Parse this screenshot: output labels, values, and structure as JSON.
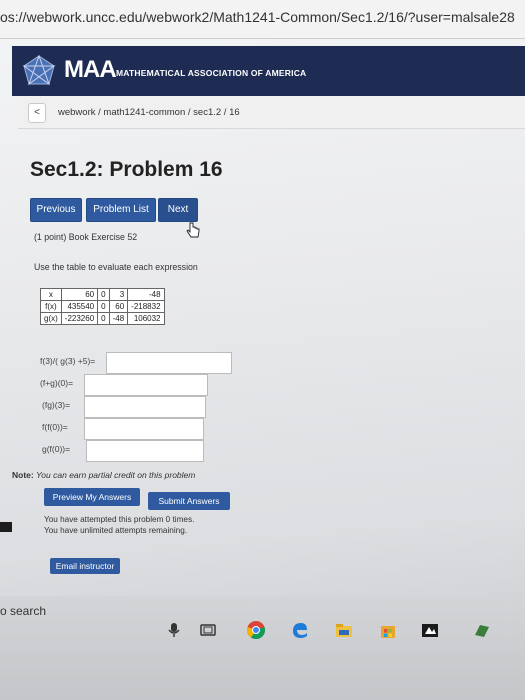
{
  "browser": {
    "url": "os://webwork.uncc.edu/webwork2/Math1241-Common/Sec1.2/16/?user=malsale28"
  },
  "header": {
    "logo_text": "MAA",
    "org_name": "MATHEMATICAL ASSOCIATION OF AMERICA"
  },
  "breadcrumb": {
    "back": "<",
    "path": "webwork / math1241-common / sec1.2 / 16"
  },
  "page": {
    "title": "Sec1.2: Problem 16"
  },
  "nav": {
    "previous": "Previous",
    "problem_list": "Problem List",
    "next": "Next"
  },
  "problem": {
    "points": "(1 point) Book Exercise 52",
    "instruction": "Use the table to evaluate each expression",
    "table": {
      "header": [
        "x",
        "60",
        "0",
        "3",
        "-48"
      ],
      "rows": [
        [
          "f(x)",
          "435540",
          "0",
          "60",
          "-218832"
        ],
        [
          "g(x)",
          "-223260",
          "0",
          "-48",
          "106032"
        ]
      ]
    },
    "questions": [
      {
        "label": "f(3)/( g(3) +5)=",
        "value": ""
      },
      {
        "label": "(f+g)(0)=",
        "value": ""
      },
      {
        "label": "(fg)(3)=",
        "value": ""
      },
      {
        "label": "f(f(0))=",
        "value": ""
      },
      {
        "label": "g(f(0))=",
        "value": ""
      }
    ]
  },
  "note": {
    "prefix": "Note:",
    "text": "You can earn partial credit on this problem"
  },
  "actions": {
    "preview": "Preview My Answers",
    "submit": "Submit Answers"
  },
  "attempts": {
    "line1": "You have attempted this problem 0 times.",
    "line2": "You have unlimited attempts remaining."
  },
  "email": {
    "label": "Email instructor"
  },
  "taskbar": {
    "search": "o search"
  }
}
